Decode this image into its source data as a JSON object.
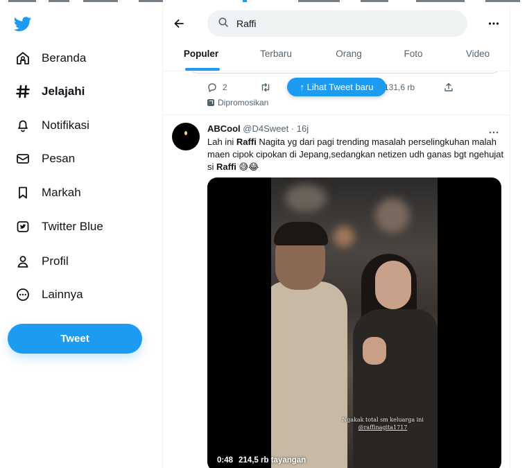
{
  "sidebar": {
    "logo": "twitter-bird-icon",
    "items": [
      {
        "label": "Beranda",
        "icon": "home-icon",
        "active": false
      },
      {
        "label": "Jelajahi",
        "icon": "hashtag-icon",
        "active": true
      },
      {
        "label": "Notifikasi",
        "icon": "bell-icon",
        "active": false
      },
      {
        "label": "Pesan",
        "icon": "envelope-icon",
        "active": false
      },
      {
        "label": "Markah",
        "icon": "bookmark-icon",
        "active": false
      },
      {
        "label": "Twitter Blue",
        "icon": "twitter-blue-icon",
        "active": false
      },
      {
        "label": "Profil",
        "icon": "person-icon",
        "active": false
      },
      {
        "label": "Lainnya",
        "icon": "more-circle-icon",
        "active": false
      }
    ],
    "tweet_button": "Tweet"
  },
  "header": {
    "search_value": "Raffi",
    "tabs": [
      "Populer",
      "Terbaru",
      "Orang",
      "Foto",
      "Video"
    ],
    "active_tab": "Populer"
  },
  "prev_tweet": {
    "replies": "2",
    "views": "131,6 rb",
    "promoted": "Dipromosikan",
    "new_tweets": "↑ Lihat Tweet baru"
  },
  "tweet": {
    "name": "ABCool",
    "handle": "@D4Sweet · 16j",
    "text_1": "Lah ini ",
    "bold_1": "Raffi",
    "text_2": " Nagita yg dari pagi trending masalah perselingkuhan malah maen cipok cipokan di Jepang,sedangkan netizen udh ganas bgt ngehujat si ",
    "bold_2": "Raffi",
    "emoji": "😅😂",
    "video": {
      "caption_line1": "Ngakak total sm keluarga ini",
      "caption_line2": "@raffinagita1717",
      "duration": "0:48",
      "views": "214,5 rb tayangan"
    }
  },
  "colors": {
    "accent": "#1d9bf0",
    "text": "#0f1419",
    "secondary": "#536471",
    "border": "#eff3f4"
  }
}
